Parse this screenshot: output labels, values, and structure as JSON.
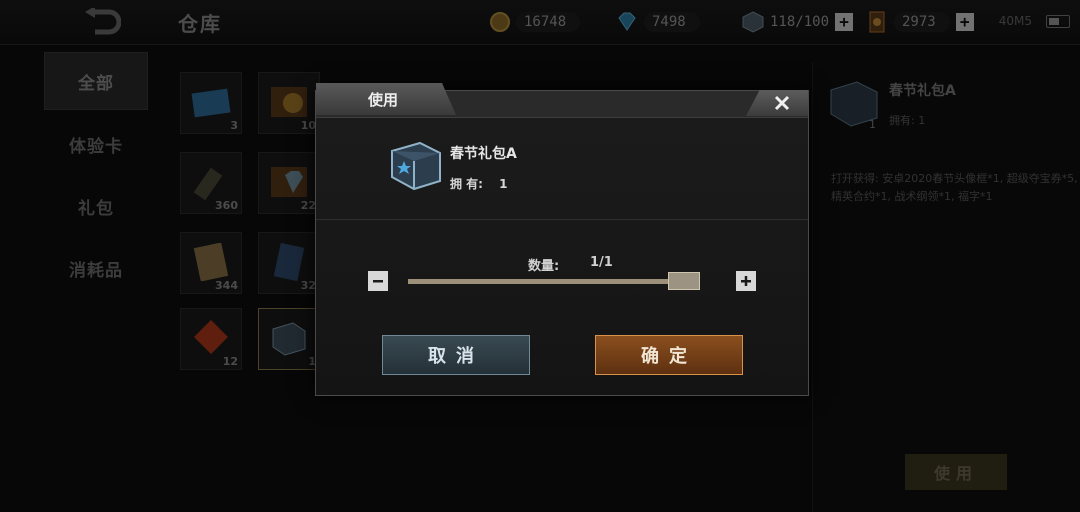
{
  "topbar": {
    "title": "仓库",
    "gold": "16748",
    "diamond": "7498",
    "capacity": "118/100",
    "honor": "2973",
    "status": "40M5"
  },
  "nav": {
    "items": [
      {
        "label": "全部",
        "active": true
      },
      {
        "label": "体验卡",
        "active": false
      },
      {
        "label": "礼包",
        "active": false
      },
      {
        "label": "消耗品",
        "active": false
      }
    ]
  },
  "grid": {
    "items": [
      {
        "qty": "3"
      },
      {
        "qty": "10"
      },
      {
        "qty": "360"
      },
      {
        "qty": "22"
      },
      {
        "qty": "344"
      },
      {
        "qty": "32"
      },
      {
        "qty": "12"
      },
      {
        "qty": "1"
      }
    ]
  },
  "detail": {
    "name": "春节礼包A",
    "owned": "拥有: 1",
    "description": "打开获得: 安卓2020春节头像框*1, 超级夺宝券*5, 精英合约*1, 战术纲领*1, 福字*1",
    "use_label": "使用",
    "icon_qty": "1"
  },
  "modal": {
    "tab_label": "使用",
    "item_name": "春节礼包A",
    "owned_label": "拥 有:",
    "owned_value": "1",
    "quantity_label": "数量:",
    "quantity_value": "1/1",
    "quantity_fraction": 1.0,
    "cancel_label": "取消",
    "confirm_label": "确定"
  },
  "colors": {
    "accent_orange": "#d8924a",
    "accent_steel": "#6f8a96"
  }
}
